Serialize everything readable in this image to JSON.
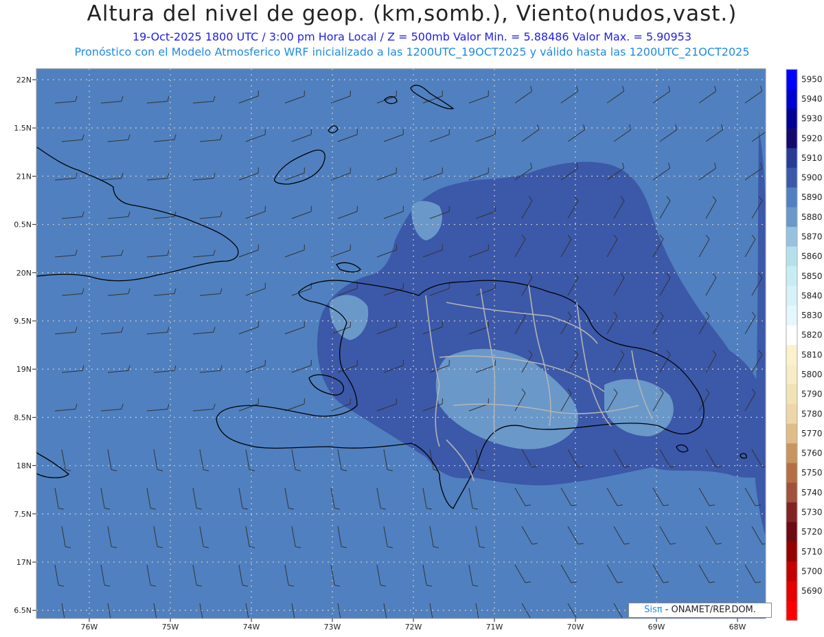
{
  "header": {
    "title": "Altura del nivel de geop. (km,somb.), Viento(nudos,vast.)",
    "subtitle_line": "19-Oct-2025   1800 UTC / 3:00 pm Hora Local / Z = 500mb      Valor Min. = 5.88486   Valor Max. = 5.90953",
    "model_line": "Pronóstico con el Modelo Atmosferico WRF inicializado a las 1200UTC_19OCT2025 y válido hasta las  1200UTC_21OCT2025"
  },
  "map": {
    "lat_ticks": [
      "22N",
      "1.5N",
      "21N",
      "0.5N",
      "20N",
      "9.5N",
      "19N",
      "8.5N",
      "18N",
      "7.5N",
      "17N",
      "6.5N"
    ],
    "lon_ticks": [
      "76W",
      "75W",
      "74W",
      "73W",
      "72W",
      "71W",
      "70W",
      "69W",
      "68W"
    ],
    "colors": {
      "background_field": "#5080bf",
      "ridge_field": "#3c58a8",
      "trough_field": "#6a98c9",
      "coastline": "#000000",
      "borders": "#b4b4b4",
      "barbs": "#333333",
      "grid": "#c8c8c8"
    }
  },
  "legend": {
    "levels": [
      "5950",
      "5940",
      "5930",
      "5920",
      "5910",
      "5900",
      "5890",
      "5880",
      "5870",
      "5860",
      "5850",
      "5840",
      "5830",
      "5820",
      "5810",
      "5800",
      "5790",
      "5780",
      "5770",
      "5760",
      "5750",
      "5740",
      "5730",
      "5720",
      "5710",
      "5700",
      "5690"
    ],
    "colors": [
      "#0000ff",
      "#0000d2",
      "#000096",
      "#140a6e",
      "#283c96",
      "#3c58a8",
      "#5080bf",
      "#6a98c9",
      "#96c2e0",
      "#b4e0ee",
      "#c8ecf4",
      "#d6f2f8",
      "#e4f8fc",
      "#ffffff",
      "#fbf2cc",
      "#f8ecc4",
      "#f2e2b4",
      "#eed6a8",
      "#e0bc88",
      "#c8955e",
      "#b47044",
      "#a0523a",
      "#802424",
      "#6e0a14",
      "#960000",
      "#c30000",
      "#e60000",
      "#ff0000"
    ]
  },
  "credit": {
    "brand": "Sisπ",
    "text": " - ONAMET/REP.DOM."
  }
}
